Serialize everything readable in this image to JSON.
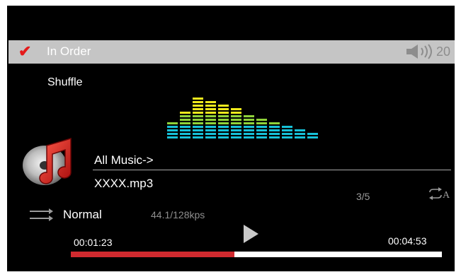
{
  "header": {
    "order_check_icon": "checkmark-icon",
    "order_mode": "In Order",
    "volume_icon": "speaker-icon",
    "volume_level": "20"
  },
  "menu": {
    "shuffle_label": "Shuffle"
  },
  "equalizer": {
    "icon": "spectrum-equalizer",
    "colors": {
      "top": "#f0ea1c",
      "mid": "#8fd23a",
      "bottom": "#16c1d8"
    },
    "bar_levels": [
      5,
      8,
      12,
      11,
      10,
      9,
      7,
      6,
      5,
      4,
      3,
      2
    ]
  },
  "now_playing": {
    "album_icon": "music-note-disc-icon",
    "playlist": "All Music->",
    "track": "XXXX.mp3",
    "track_count": "3/5",
    "repeat_icon": "repeat-a-icon",
    "repeat_label": "A",
    "play_mode_icon": "shuffle-arrows-icon",
    "play_mode": "Normal",
    "bitrate": "44.1/128kps",
    "play_icon": "play-icon"
  },
  "progress": {
    "elapsed": "00:01:23",
    "total": "00:04:53",
    "fraction": 0.44,
    "fill_color": "#d02a2f",
    "track_color": "#ffffff"
  },
  "colors": {
    "background": "#000000",
    "order_bar": "#c5c5c5",
    "accent": "#e41a1a"
  }
}
